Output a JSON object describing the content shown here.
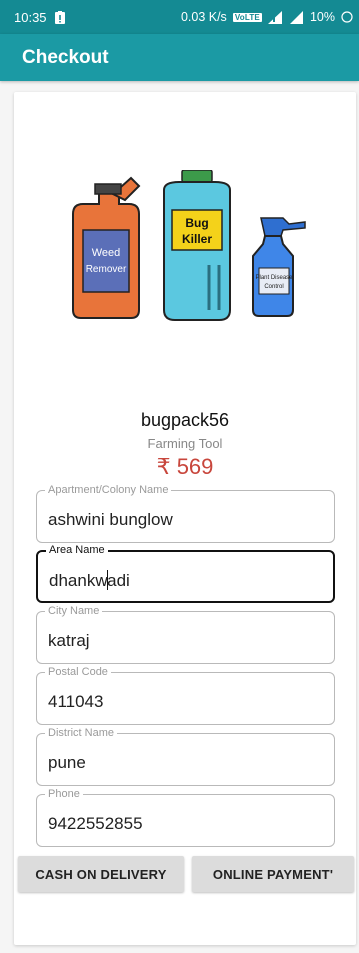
{
  "status_bar": {
    "time": "10:35",
    "speed": "0.03 K/s",
    "network_badge": "VoLTE",
    "battery": "10%"
  },
  "app_bar": {
    "title": "Checkout"
  },
  "product": {
    "name": "bugpack56",
    "category": "Farming Tool",
    "price": "₹ 569",
    "image_labels": {
      "jug_line1": "Weed",
      "jug_line2": "Remover",
      "can_line1": "Bug",
      "can_line2": "Killer",
      "spray_line1": "Plant Disease",
      "spray_line2": "Control"
    }
  },
  "form": {
    "apartment": {
      "label": "Apartment/Colony Name",
      "value": "ashwini bunglow"
    },
    "area": {
      "label": "Area Name",
      "value_before_cursor": "dhankw",
      "value_after_cursor": "adi"
    },
    "city": {
      "label": "City Name",
      "value": "katraj"
    },
    "postal": {
      "label": "Postal Code",
      "value": "411043"
    },
    "district": {
      "label": "District Name",
      "value": "pune"
    },
    "phone": {
      "label": "Phone",
      "value": "9422552855"
    }
  },
  "actions": {
    "cod": "CASH ON DELIVERY",
    "online": "ONLINE PAYMENT'"
  },
  "colors": {
    "status_bar": "#148a93",
    "app_bar": "#1b9aa4",
    "price": "#c8463c"
  }
}
